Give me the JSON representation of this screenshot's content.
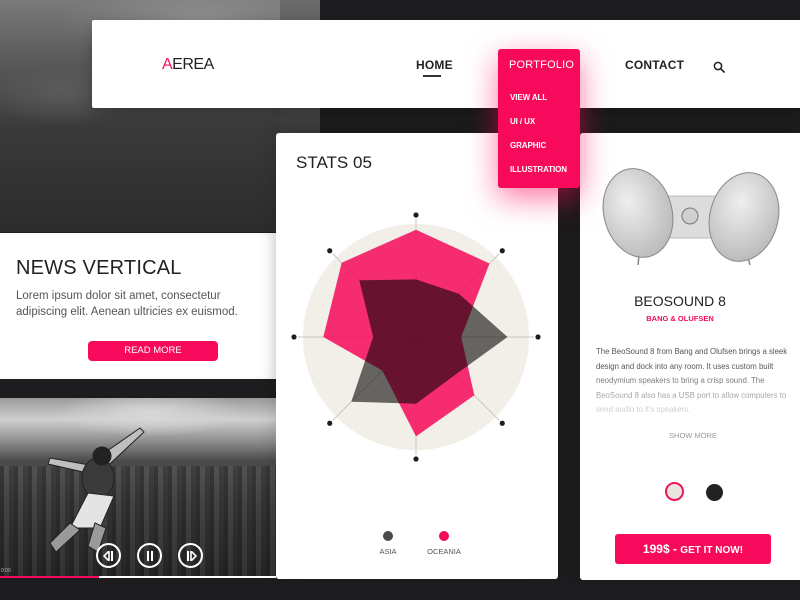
{
  "header": {
    "logo_accent": "A",
    "logo_rest": "EREA",
    "nav": {
      "home": "HOME",
      "portfolio": "PORTFOLIO",
      "contact": "CONTACT"
    },
    "active_item": "HOME",
    "search_icon": "search-icon"
  },
  "portfolio_dropdown": {
    "title": "PORTFOLIO",
    "items": [
      "VIEW ALL",
      "UI / UX",
      "GRAPHIC",
      "ILLUSTRATION"
    ]
  },
  "news": {
    "title": "NEWS VERTICAL",
    "body": "Lorem ipsum dolor sit amet, consectetur adipiscing elit. Aenean ultricies ex euismod.",
    "button": "READ MORE"
  },
  "video": {
    "time": "0:00",
    "progress": 0.36,
    "controls": [
      "previous-icon",
      "pause-icon",
      "next-icon"
    ]
  },
  "stats": {
    "title": "STATS 05"
  },
  "chart_data": {
    "type": "radar",
    "title": "STATS 05",
    "axes": [
      "A1",
      "A2",
      "A3",
      "A4",
      "A5",
      "A6",
      "A7",
      "A8"
    ],
    "axis_labels_visible": false,
    "range": [
      0,
      1
    ],
    "grid": false,
    "legend_position": "bottom",
    "series": [
      {
        "name": "ASIA",
        "color": "#4a4a4a",
        "values": [
          0.51,
          0.54,
          0.81,
          0.48,
          0.59,
          0.81,
          0.38,
          0.71
        ]
      },
      {
        "name": "OCEANIA",
        "color": "#f7095b",
        "values": [
          0.95,
          0.92,
          0.4,
          0.73,
          0.88,
          0.42,
          0.82,
          0.93
        ]
      }
    ]
  },
  "product": {
    "name": "BEOSOUND 8",
    "brand": "BANG & OLUFSEN",
    "description": "The BeoSound 8 from Bang and Olufsen brings a sleek design and dock into any room. It uses custom built neodymium speakers to bring a crisp sound. The BeoSound 8 also has a USB port to allow computers to send audio to it's speakers.",
    "show_more": "SHOW MORE",
    "colors": [
      {
        "name": "light",
        "hex": "#e9e6e0",
        "selected": true
      },
      {
        "name": "dark",
        "hex": "#222222",
        "selected": false
      }
    ],
    "buy_price": "199$",
    "buy_separator": " - ",
    "buy_cta": "GET IT NOW!"
  },
  "theme": {
    "accent": "#f7095b",
    "dark": "#1d1c1e"
  }
}
